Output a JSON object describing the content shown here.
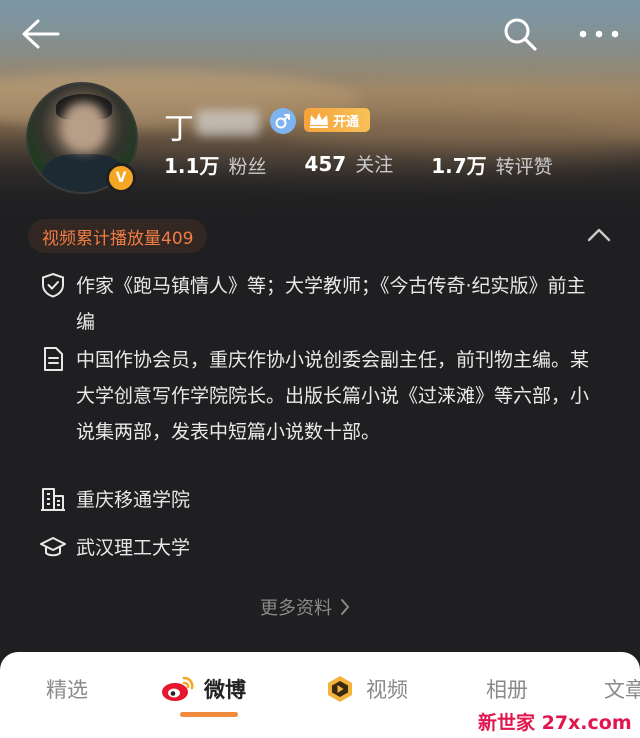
{
  "profile": {
    "name_visible": "丁",
    "vip_label": "开通",
    "verified_badge": "V",
    "stats": [
      {
        "num": "1.1万",
        "label": "粉丝"
      },
      {
        "num": "457",
        "label": "关注"
      },
      {
        "num": "1.7万",
        "label": "转评赞"
      }
    ]
  },
  "video_count_label": "视频累计播放量409",
  "info": [
    {
      "icon": "shield-icon",
      "text": "作家《跑马镇情人》等；大学教师；《今古传奇·纪实版》前主编"
    },
    {
      "icon": "document-icon",
      "text": "中国作协会员，重庆作协小说创委会副主任，前刊物主编。某大学创意写作学院院长。出版长篇小说《过涞滩》等六部，小说集两部，发表中短篇小说数十部。"
    },
    {
      "icon": "building-icon",
      "text": "重庆移通学院"
    },
    {
      "icon": "graduation-cap-icon",
      "text": "武汉理工大学"
    }
  ],
  "more_info_label": "更多资料",
  "tabs": [
    {
      "label": "精选"
    },
    {
      "label": "微博"
    },
    {
      "label": "视频"
    },
    {
      "label": "相册"
    },
    {
      "label": "文章"
    }
  ],
  "watermark": "新世家 27x.com",
  "colors": {
    "accent": "#f07d45",
    "vip": "#f6a33b",
    "gender_male": "#7fb3f0",
    "tab_underline": "#f08a3c",
    "watermark": "#e0164f"
  }
}
